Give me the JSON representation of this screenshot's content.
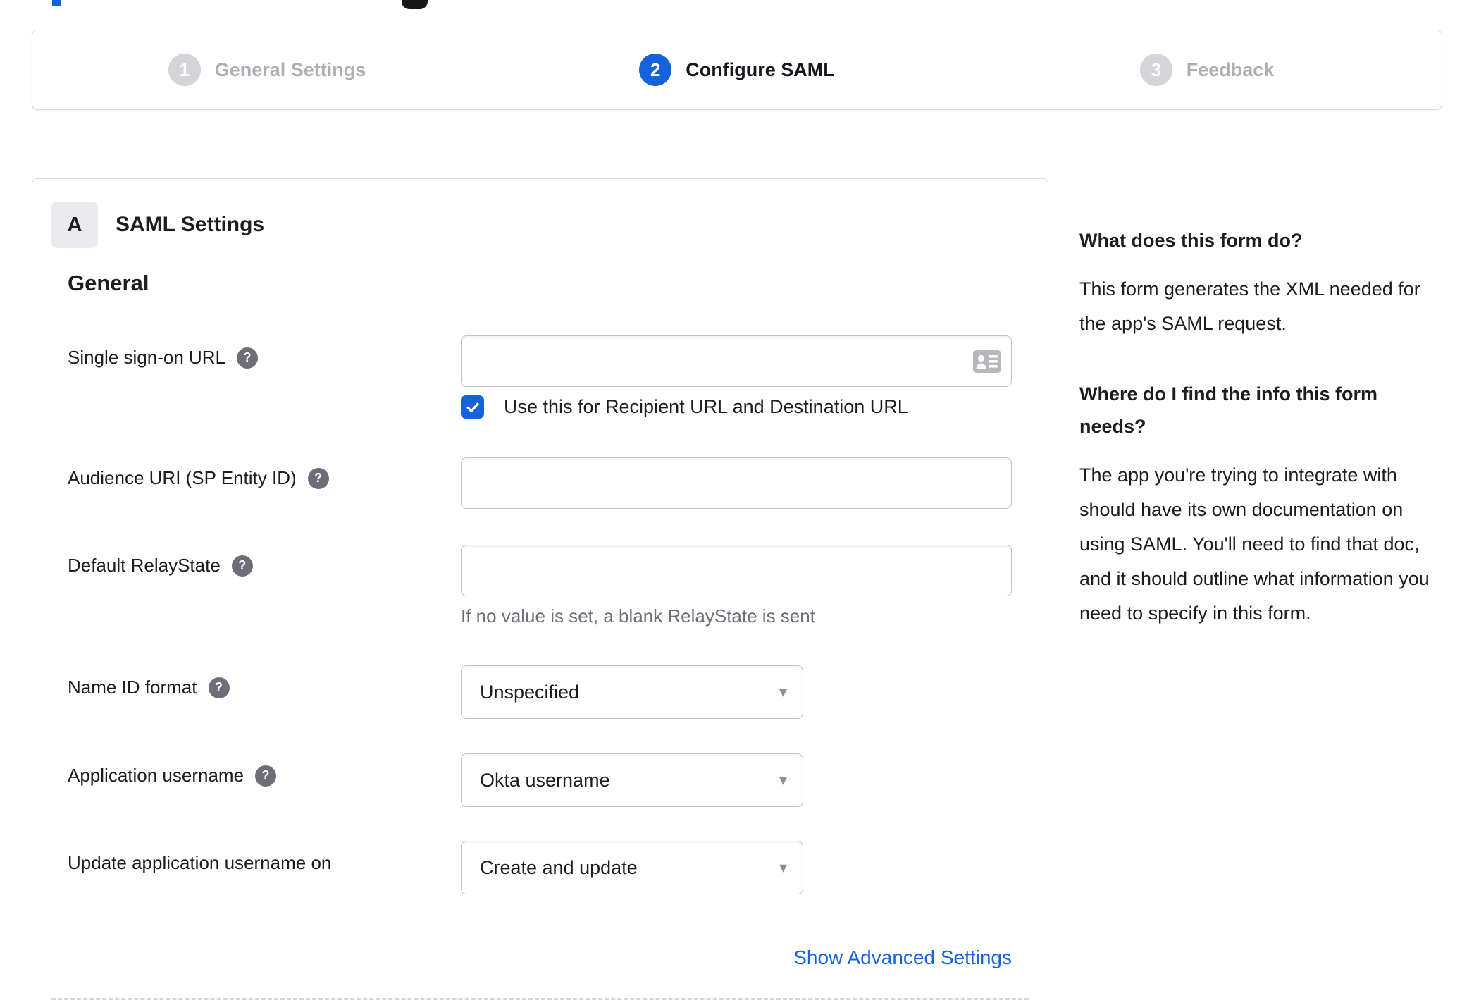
{
  "stepper": {
    "steps": [
      {
        "number": "1",
        "label": "General Settings",
        "active": false
      },
      {
        "number": "2",
        "label": "Configure SAML",
        "active": true
      },
      {
        "number": "3",
        "label": "Feedback",
        "active": false
      }
    ]
  },
  "panel": {
    "badge": "A",
    "title": "SAML Settings",
    "section": "General",
    "sso": {
      "label": "Single sign-on URL",
      "value": "",
      "checkbox_label": "Use this for Recipient URL and Destination URL",
      "checkbox_checked": true
    },
    "audience": {
      "label": "Audience URI (SP Entity ID)",
      "value": ""
    },
    "relay": {
      "label": "Default RelayState",
      "value": "",
      "hint": "If no value is set, a blank RelayState is sent"
    },
    "name_id": {
      "label": "Name ID format",
      "value": "Unspecified"
    },
    "app_user": {
      "label": "Application username",
      "value": "Okta username"
    },
    "update_user": {
      "label": "Update application username on",
      "value": "Create and update"
    },
    "advanced_link": "Show Advanced Settings"
  },
  "help": {
    "q1": "What does this form do?",
    "a1": "This form generates the XML needed for the app's SAML request.",
    "q2": "Where do I find the info this form needs?",
    "a2": "The app you're trying to integrate with should have its own documentation on using SAML. You'll need to find that doc, and it should outline what information you need to specify in this form."
  },
  "icons": {
    "help_glyph": "?",
    "caret": "▾"
  },
  "colors": {
    "accent": "#1662dd",
    "text": "#1d1d21",
    "muted": "#6e6e78",
    "inactive_step": "#aeaeb4",
    "border": "#d9d9de"
  }
}
